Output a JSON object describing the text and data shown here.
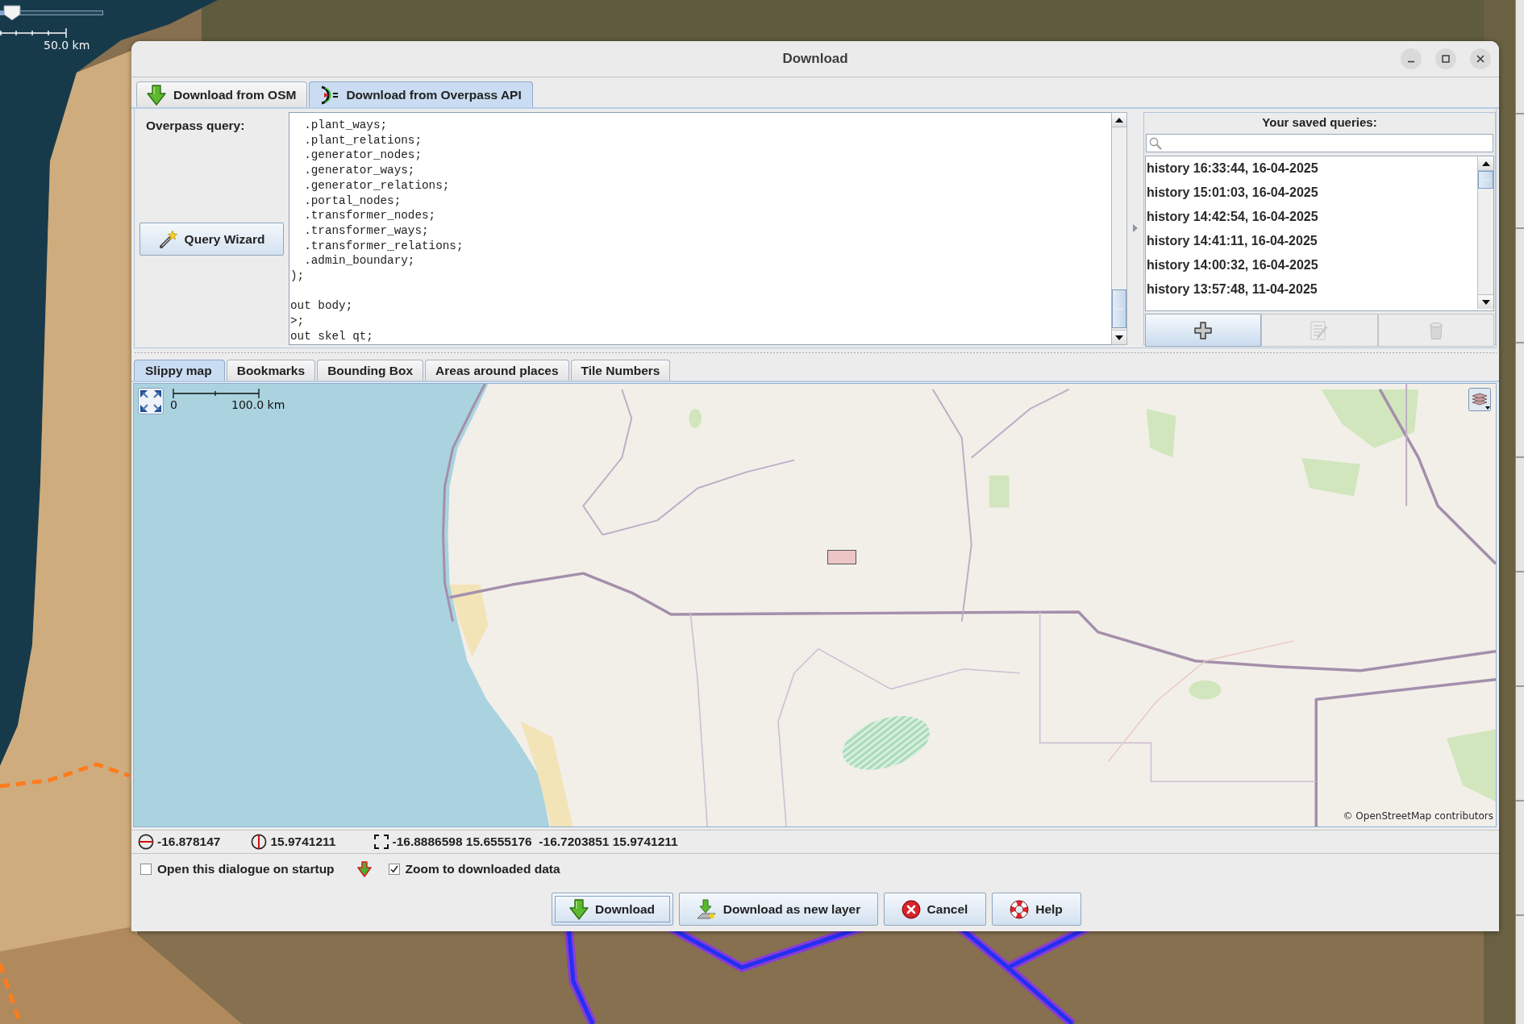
{
  "background": {
    "zoom_slider": {
      "level": 0.12
    },
    "scale_label": "50.0 km"
  },
  "window": {
    "title": "Download"
  },
  "tabs": [
    {
      "label": "Download from OSM",
      "kind": "osm",
      "selected": false
    },
    {
      "label": "Download from Overpass API",
      "kind": "overpass",
      "selected": true
    }
  ],
  "query": {
    "label": "Overpass query:",
    "wizard_button": "Query Wizard",
    "value": "  .plant_ways;\n  .plant_relations;\n  .generator_nodes;\n  .generator_ways;\n  .generator_relations;\n  .portal_nodes;\n  .transformer_nodes;\n  .transformer_ways;\n  .transformer_relations;\n  .admin_boundary;\n);\n\nout body;\n>;\nout skel qt;"
  },
  "saved_queries": {
    "title": "Your saved queries:",
    "items": [
      {
        "label": "history 16:33:44, 16-04-2025",
        "selected": false
      },
      {
        "label": "history 15:01:03, 16-04-2025",
        "selected": false
      },
      {
        "label": "history 14:42:54, 16-04-2025",
        "selected": false
      },
      {
        "label": "history 14:41:11, 16-04-2025",
        "selected": false
      },
      {
        "label": "history 14:00:32, 16-04-2025",
        "selected": false
      },
      {
        "label": "history 13:57:48, 11-04-2025",
        "selected": false
      }
    ],
    "buttons": [
      {
        "kind": "add",
        "disabled": false
      },
      {
        "kind": "edit",
        "disabled": true
      },
      {
        "kind": "delete",
        "disabled": true
      }
    ]
  },
  "map_tabs": [
    {
      "label": "Slippy map",
      "selected": true
    },
    {
      "label": "Bookmarks",
      "selected": false
    },
    {
      "label": "Bounding Box",
      "selected": false
    },
    {
      "label": "Areas around places",
      "selected": false
    },
    {
      "label": "Tile Numbers",
      "selected": false
    }
  ],
  "map": {
    "scale_start": "0",
    "scale_end": "100.0 km",
    "attribution": "© OpenStreetMap contributors"
  },
  "coordinates": [
    {
      "kind": "latitude",
      "value": "-16.878147"
    },
    {
      "kind": "longitude",
      "value": "15.9741211"
    },
    {
      "kind": "bounds",
      "value": "-16.8886598 15.6555176  -16.7203851 15.9741211"
    }
  ],
  "options": [
    {
      "label": "Open this dialogue on startup",
      "kind": "startup",
      "checked": false
    },
    {
      "label": "Zoom to downloaded data",
      "kind": "zoom",
      "checked": true
    }
  ],
  "buttons": [
    {
      "label": "Download",
      "kind": "download",
      "focused": true
    },
    {
      "label": "Download as new layer",
      "kind": "new_layer",
      "focused": false
    },
    {
      "label": "Cancel",
      "kind": "cancel",
      "focused": false
    },
    {
      "label": "Help",
      "kind": "help",
      "focused": false
    }
  ]
}
